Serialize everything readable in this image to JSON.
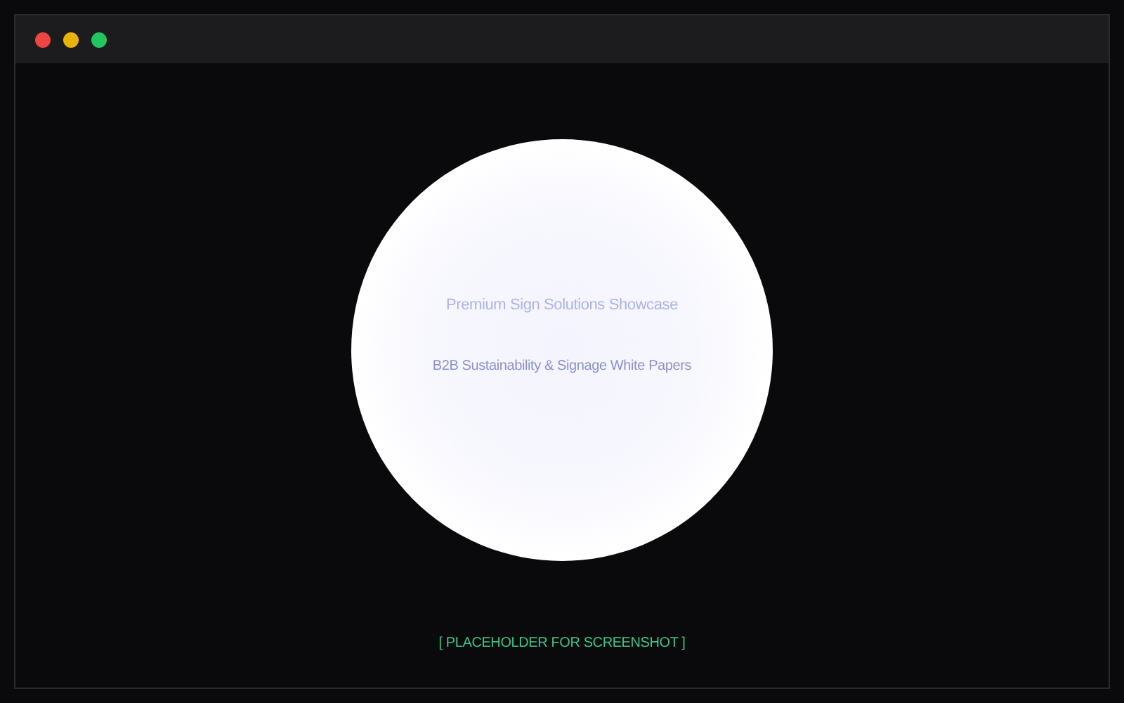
{
  "window": {
    "controls": [
      {
        "color": "#ef4444"
      },
      {
        "color": "#eab308"
      },
      {
        "color": "#22c55e"
      }
    ]
  },
  "hero": {
    "title": "Premium Sign Solutions Showcase",
    "subtitle": "B2B Sustainability & Signage White Papers"
  },
  "caption": "[ PLACEHOLDER FOR SCREENSHOT ]"
}
